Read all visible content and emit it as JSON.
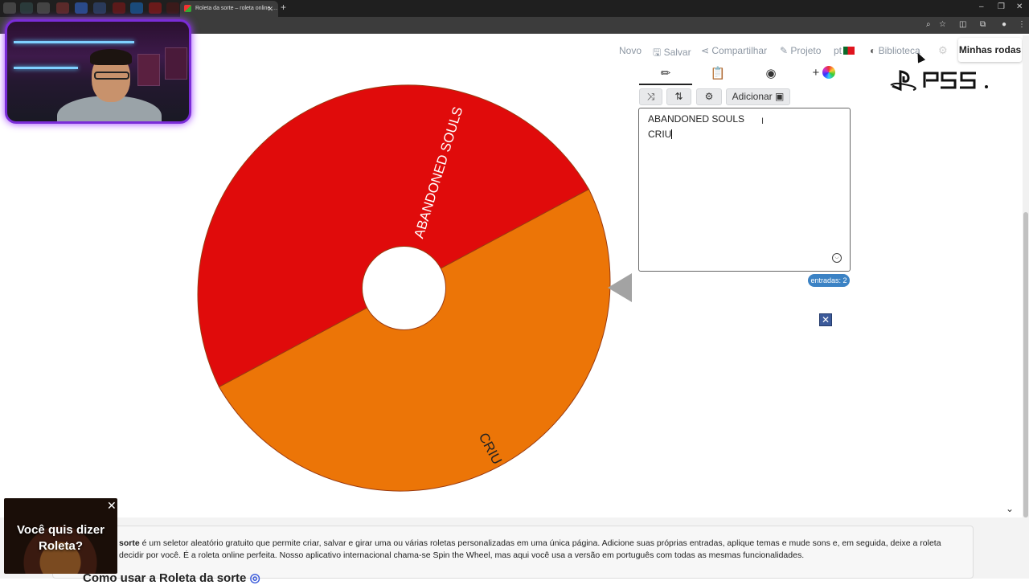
{
  "browser": {
    "active_tab_title": "Roleta da sorte – roleta online …",
    "tab_close": "✕",
    "new_tab": "+"
  },
  "nav": {
    "novo": "Novo",
    "salvar": "Salvar",
    "compartilhar": "Compartilhar",
    "projeto": "Projeto",
    "lang": "pt",
    "biblioteca": "Biblioteca",
    "minhas_rodas": "Minhas rodas"
  },
  "panel": {
    "tabs": [
      "edit-icon",
      "clipboard-icon",
      "hide-icon",
      "add-color-icon"
    ],
    "buttons": {
      "adicionar": "Adicionar"
    },
    "entries": [
      "ABANDONED SOULS",
      "CRIU"
    ],
    "entries_badge": "entradas: 2"
  },
  "wheel": {
    "segments": [
      {
        "label": "ABANDONED SOULS",
        "color": "#e00b0b"
      },
      {
        "label": "CRIU",
        "color": "#ec7507"
      }
    ]
  },
  "description": {
    "bold_lead": "sorte",
    "text": " é um seletor aleatório gratuito que permite criar, salvar e girar uma ou várias roletas personalizadas em uma única página. Adicione suas próprias entradas, aplique temas e mude sons e, em seguida, deixe a roleta decidir por você. É a roleta online perfeita. Nosso aplicativo internacional chama-se Spin the Wheel, mas aqui você usa a versão em português com todas as mesmas funcionalidades.",
    "howto_heading": "Como usar a Roleta da sorte"
  },
  "promo": {
    "line1": "Você quis dizer",
    "line2": "Roleta?"
  },
  "colors": {
    "red_segment": "#e00b0b",
    "orange_segment": "#ec7507",
    "badge": "#3b82c4",
    "webcam_border": "#7a2cd8"
  }
}
